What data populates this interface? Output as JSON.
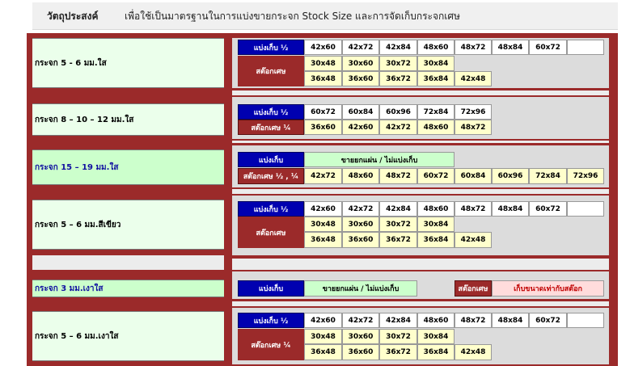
{
  "header": {
    "label": "วัตถุประสงค์",
    "text": "เพื่อใช้เป็นมาตรฐานในการแบ่งขายกระจก Stock Size  และการจัดเก็บกระจกเศษ"
  },
  "sections": [
    {
      "name": "กระจก 5  - 6 มม.ใส",
      "cut_label": "แบ่งเก็บ ½",
      "scrap_label": "สต๊อกเศษ",
      "cut_sizes": [
        "42x60",
        "42x72",
        "42x84",
        "48x60",
        "48x72",
        "48x84",
        "60x72",
        ""
      ],
      "scrap_row1": [
        "30x48",
        "30x60",
        "30x72",
        "30x84"
      ],
      "scrap_row2": [
        "36x48",
        "36x60",
        "36x72",
        "36x84",
        "42x48"
      ]
    },
    {
      "name": "กระจก 8 – 10 – 12  มม.ใส",
      "cut_label": "แบ่งเก็บ ½",
      "scrap_label": "สต๊อกเศษ ¼",
      "cut_sizes": [
        "60x72",
        "60x84",
        "60x96",
        "72x84",
        "72x96"
      ],
      "scrap_sizes": [
        "36x60",
        "42x60",
        "42x72",
        "48x60",
        "48x72"
      ]
    },
    {
      "name": "กระจก 15 – 19  มม.ใส",
      "cut_label": "แบ่งเก็บ",
      "note": "ขายยกแผ่น / ไม่แบ่งเก็บ",
      "scrap_label": "สต๊อกเศษ ½ , ¼",
      "scrap_sizes": [
        "42x72",
        "48x60",
        "48x72",
        "60x72",
        "60x84",
        "60x96",
        "72x84",
        "72x96"
      ]
    },
    {
      "name": "กระจก 5 – 6 มม.สีเขียว",
      "cut_label": "แบ่งเก็บ ½",
      "scrap_label": "สต๊อกเศษ",
      "cut_sizes": [
        "42x60",
        "42x72",
        "42x84",
        "48x60",
        "48x72",
        "48x84",
        "60x72",
        ""
      ],
      "scrap_row1": [
        "30x48",
        "30x60",
        "30x72",
        "30x84"
      ],
      "scrap_row2": [
        "36x48",
        "36x60",
        "36x72",
        "36x84",
        "42x48"
      ]
    },
    {
      "name": "กระจก 3 มม.เงาใส",
      "cut_label": "แบ่งเก็บ",
      "note": "ขายยกแผ่น / ไม่แบ่งเก็บ",
      "scrap_label": "สต๊อกเศษ",
      "scrap_note": "เก็บขนาดเท่ากับสต๊อก"
    },
    {
      "name": "กระจก 5 – 6  มม.เงาใส",
      "cut_label": "แบ่งเก็บ ½",
      "scrap_label": "สต๊อกเศษ ¼",
      "cut_sizes": [
        "42x60",
        "42x72",
        "42x84",
        "48x60",
        "48x72",
        "48x84",
        "60x72",
        ""
      ],
      "scrap_row1": [
        "30x48",
        "30x60",
        "30x72",
        "30x84"
      ],
      "scrap_row2": [
        "36x48",
        "36x60",
        "36x72",
        "36x84",
        "42x48"
      ]
    }
  ],
  "colors": {
    "header_blue": "#0000b0",
    "header_red": "#9b2a2a",
    "yellow_cell": "#ffffcc",
    "green_cell": "#ccffcc",
    "pink_cell": "#ffdcdc"
  }
}
